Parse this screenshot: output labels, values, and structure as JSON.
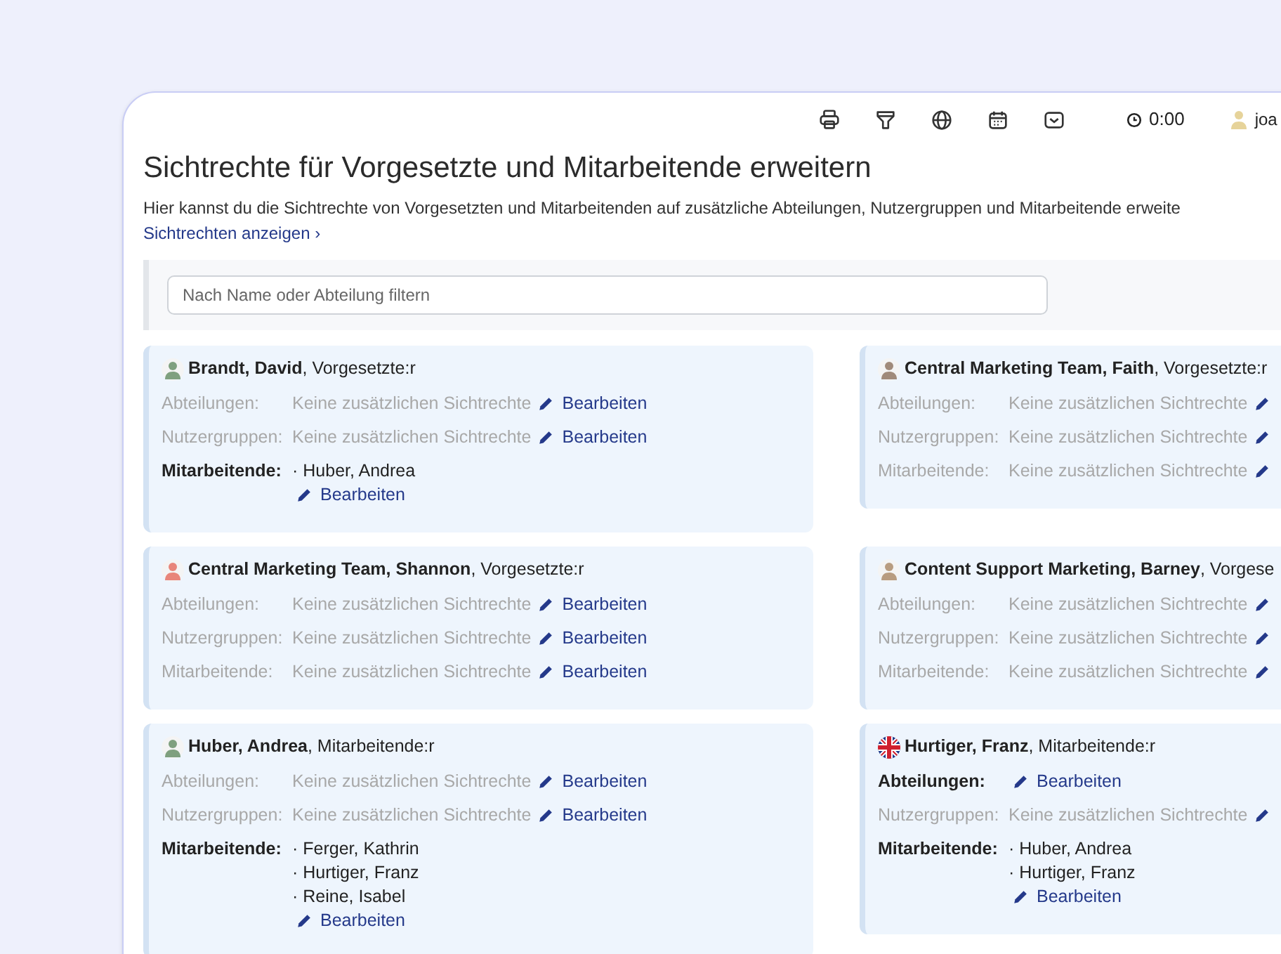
{
  "toolbar": {
    "clock": "0:00",
    "user": "joa"
  },
  "title": "Sichtrechte für Vorgesetzte und Mitarbeitende erweitern",
  "description": "Hier kannst du die Sichtrechte von Vorgesetzten und Mitarbeitenden auf zusätzliche Abteilungen, Nutzergruppen und Mitarbeitende erweite",
  "link": "Sichtrechten anzeigen ›",
  "filter": {
    "placeholder": "Nach Name oder Abteilung filtern"
  },
  "cards": [
    {
      "avatar": {
        "kind": "person",
        "color": "#7fa07f"
      },
      "header": "**Brandt, David**, Vorgesetzte:r",
      "rows": [
        {
          "label": "Abteilungen:",
          "has_rights": false,
          "value": "Keine zusätzlichen Sichtrechte",
          "edit": "Bearbeiten"
        },
        {
          "label": "Nutzergruppen:",
          "has_rights": false,
          "value": "Keine zusätzlichen Sichtrechte",
          "edit": "Bearbeiten"
        },
        {
          "label": "Mitarbeitende:",
          "has_rights": true,
          "items": [
            "· Huber, Andrea"
          ],
          "edit": "Bearbeiten"
        }
      ]
    },
    {
      "avatar": {
        "kind": "person",
        "color": "#a08a7a"
      },
      "header": "**Central Marketing Team, Faith**, Vorgesetzte:r",
      "rows": [
        {
          "label": "Abteilungen:",
          "has_rights": false,
          "value": "Keine zusätzlichen Sichtrechte"
        },
        {
          "label": "Nutzergruppen:",
          "has_rights": false,
          "value": "Keine zusätzlichen Sichtrechte"
        },
        {
          "label": "Mitarbeitende:",
          "has_rights": false,
          "value": "Keine zusätzlichen Sichtrechte"
        }
      ]
    },
    {
      "avatar": {
        "kind": "person",
        "color": "#e8857a"
      },
      "header": "**Central Marketing Team, Shannon**, Vorgesetzte:r",
      "rows": [
        {
          "label": "Abteilungen:",
          "has_rights": false,
          "value": "Keine zusätzlichen Sichtrechte",
          "edit": "Bearbeiten"
        },
        {
          "label": "Nutzergruppen:",
          "has_rights": false,
          "value": "Keine zusätzlichen Sichtrechte",
          "edit": "Bearbeiten"
        },
        {
          "label": "Mitarbeitende:",
          "has_rights": false,
          "value": "Keine zusätzlichen Sichtrechte",
          "edit": "Bearbeiten"
        }
      ]
    },
    {
      "avatar": {
        "kind": "person",
        "color": "#b89c80"
      },
      "header": "**Content Support Marketing, Barney**, Vorgese",
      "rows": [
        {
          "label": "Abteilungen:",
          "has_rights": false,
          "value": "Keine zusätzlichen Sichtrechte"
        },
        {
          "label": "Nutzergruppen:",
          "has_rights": false,
          "value": "Keine zusätzlichen Sichtrechte"
        },
        {
          "label": "Mitarbeitende:",
          "has_rights": false,
          "value": "Keine zusätzlichen Sichtrechte"
        }
      ]
    },
    {
      "avatar": {
        "kind": "person",
        "color": "#7fa07f"
      },
      "header": "**Huber, Andrea**, Mitarbeitende:r",
      "rows": [
        {
          "label": "Abteilungen:",
          "has_rights": false,
          "value": "Keine zusätzlichen Sichtrechte",
          "edit": "Bearbeiten"
        },
        {
          "label": "Nutzergruppen:",
          "has_rights": false,
          "value": "Keine zusätzlichen Sichtrechte",
          "edit": "Bearbeiten"
        },
        {
          "label": "Mitarbeitende:",
          "has_rights": true,
          "items": [
            "· Ferger, Kathrin",
            "· Hurtiger, Franz",
            "· Reine, Isabel"
          ],
          "edit": "Bearbeiten"
        }
      ]
    },
    {
      "avatar": {
        "kind": "flag"
      },
      "header": "**Hurtiger, Franz**, Mitarbeitende:r",
      "rows": [
        {
          "label": "Abteilungen:",
          "has_rights": true,
          "items": [],
          "edit": "Bearbeiten"
        },
        {
          "label": "Nutzergruppen:",
          "has_rights": false,
          "value": "Keine zusätzlichen Sichtrechte"
        },
        {
          "label": "Mitarbeitende:",
          "has_rights": true,
          "items": [
            "· Huber, Andrea",
            "· Hurtiger, Franz"
          ],
          "edit": "Bearbeiten"
        }
      ]
    }
  ]
}
